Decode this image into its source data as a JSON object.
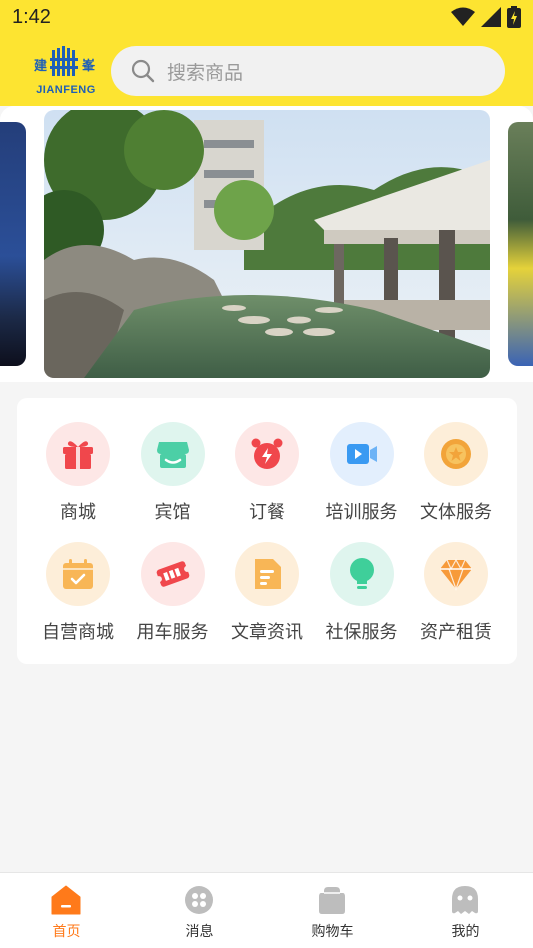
{
  "status_bar": {
    "time": "1:42"
  },
  "header": {
    "logo": {
      "text": "JIANFENG",
      "glyph_left": "建",
      "glyph_right": "峯"
    },
    "search": {
      "placeholder": "搜索商品"
    }
  },
  "banner": {
    "slides": 3,
    "current_index": 1,
    "image": "campus-pond-pavilion-photo"
  },
  "services": [
    {
      "label": "商城",
      "icon": "gift-icon",
      "bg": "#fde7e6",
      "color": "#f0474c"
    },
    {
      "label": "宾馆",
      "icon": "shop-icon",
      "bg": "#dff5ee",
      "color": "#4ccfa6"
    },
    {
      "label": "订餐",
      "icon": "alarm-clock-icon",
      "bg": "#fde7e6",
      "color": "#f0474c"
    },
    {
      "label": "培训服务",
      "icon": "video-icon",
      "bg": "#e3effd",
      "color": "#3a9af2"
    },
    {
      "label": "文体服务",
      "icon": "medal-icon",
      "bg": "#fdeed9",
      "color": "#f2a43a"
    },
    {
      "label": "自营商城",
      "icon": "calendar-icon",
      "bg": "#fdeed9",
      "color": "#f8b656"
    },
    {
      "label": "用车服务",
      "icon": "ticket-icon",
      "bg": "#fde7e6",
      "color": "#f0474c"
    },
    {
      "label": "文章资讯",
      "icon": "document-icon",
      "bg": "#fdeed9",
      "color": "#f8b656"
    },
    {
      "label": "社保服务",
      "icon": "lightbulb-icon",
      "bg": "#dff5ee",
      "color": "#3fcf9a"
    },
    {
      "label": "资产租赁",
      "icon": "diamond-icon",
      "bg": "#fdeed9",
      "color": "#f79a3a"
    }
  ],
  "tabbar": {
    "active": "首页",
    "active_color": "#ff7a1a",
    "items": [
      {
        "label": "首页",
        "icon": "home-icon"
      },
      {
        "label": "消息",
        "icon": "message-icon"
      },
      {
        "label": "购物车",
        "icon": "cart-icon"
      },
      {
        "label": "我的",
        "icon": "profile-icon"
      }
    ]
  }
}
